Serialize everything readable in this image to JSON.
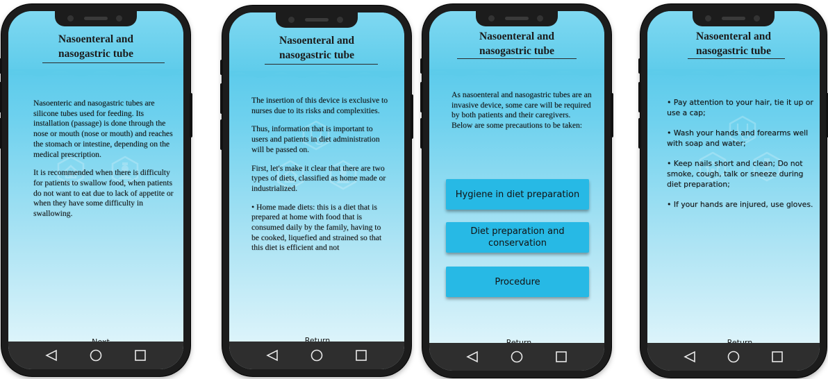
{
  "screens": [
    {
      "title": "Nasoenteral and nasogastric tube",
      "paragraphs": [
        "Nasoenteric and nasogastric tubes are silicone tubes used for feeding. Its installation (passage) is done through the nose or mouth (nose or mouth) and reaches the stomach or intestine, depending on the medical prescription.",
        "It is recommended when there is difficulty for patients to swallow food, when patients do not want to eat due to lack of appetite or when they have some difficulty in swallowing."
      ],
      "nav_label": "Next"
    },
    {
      "title": "Nasoenteral and nasogastric tube",
      "paragraphs": [
        "The insertion of this device is exclusive to nurses due to its risks and complexities.",
        "Thus, information that is important to users and patients in diet administration will be passed on.",
        "First, let's make it clear that there are two types of diets, classified as home made or industrialized.",
        "• Home made diets: this is a diet that is prepared at home with food that is consumed daily by the family, having to be cooked, liquefied and strained so that this diet is efficient and not"
      ],
      "nav_label": "Return"
    },
    {
      "title": "Nasoenteral and nasogastric tube",
      "intro": "As nasoenteral and nasogastric tubes are an invasive device, some care will be required by both patients and their caregivers.  Below are some precautions to be taken:",
      "buttons": [
        "Hygiene in diet preparation",
        "Diet preparation and conservation",
        "Procedure"
      ],
      "nav_label": "Return"
    },
    {
      "title": "Nasoenteral and nasogastric tube",
      "bullets": [
        "•  Pay attention to your hair, tie it up or use a cap;",
        "•  Wash your hands and forearms well with soap and water;",
        "•  Keep nails short and clean;  Do not smoke, cough, talk or sneeze during diet preparation;",
        "•  If your hands are injured, use gloves."
      ],
      "nav_label": "Return"
    }
  ],
  "system_nav": {
    "back_icon": "back-triangle-icon",
    "home_icon": "home-circle-icon",
    "recents_icon": "recents-square-icon"
  },
  "colors": {
    "screen_top": "#46c3e7",
    "screen_bottom": "#e9f8fc",
    "button": "#27b9e5",
    "navbar": "#2e2e2e",
    "frame": "#1c1c1c"
  }
}
